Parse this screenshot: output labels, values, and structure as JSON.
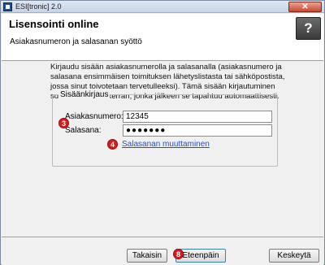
{
  "window": {
    "title": "ESI[tronic] 2.0",
    "close_label": "✕"
  },
  "header": {
    "title": "Lisensointi online",
    "subtitle": "Asiakasnumeron ja salasanan syöttö",
    "help_label": "?"
  },
  "content": {
    "intro_text": "Kirjaudu sisään asiakasnumerolla ja salasanalla (asiakasnumero ja salasana ensimmäisen toimituksen lähetyslistasta tai sähköpostista, jossa sinut toivotetaan tervetulleeksi). Tämä sisään kirjautuminen suoritetaan vain kerran, jonka jälkeen se tapahtuu automaattisesti.",
    "login_group": {
      "title": "Sisäänkirjaus",
      "customer_number_label": "Asiakasnumero:",
      "customer_number_value": "12345",
      "password_label": "Salasana:",
      "password_value": "●●●●●●●",
      "change_password_link": "Salasanan muuttaminen"
    }
  },
  "markers": {
    "m3": "3",
    "m4": "4",
    "m8": "8"
  },
  "footer": {
    "back_label": "Takaisin",
    "next_label": "Eteenpäin",
    "cancel_label": "Keskeytä"
  },
  "colors": {
    "marker": "#d41c1c",
    "link": "#1f4fc9"
  }
}
